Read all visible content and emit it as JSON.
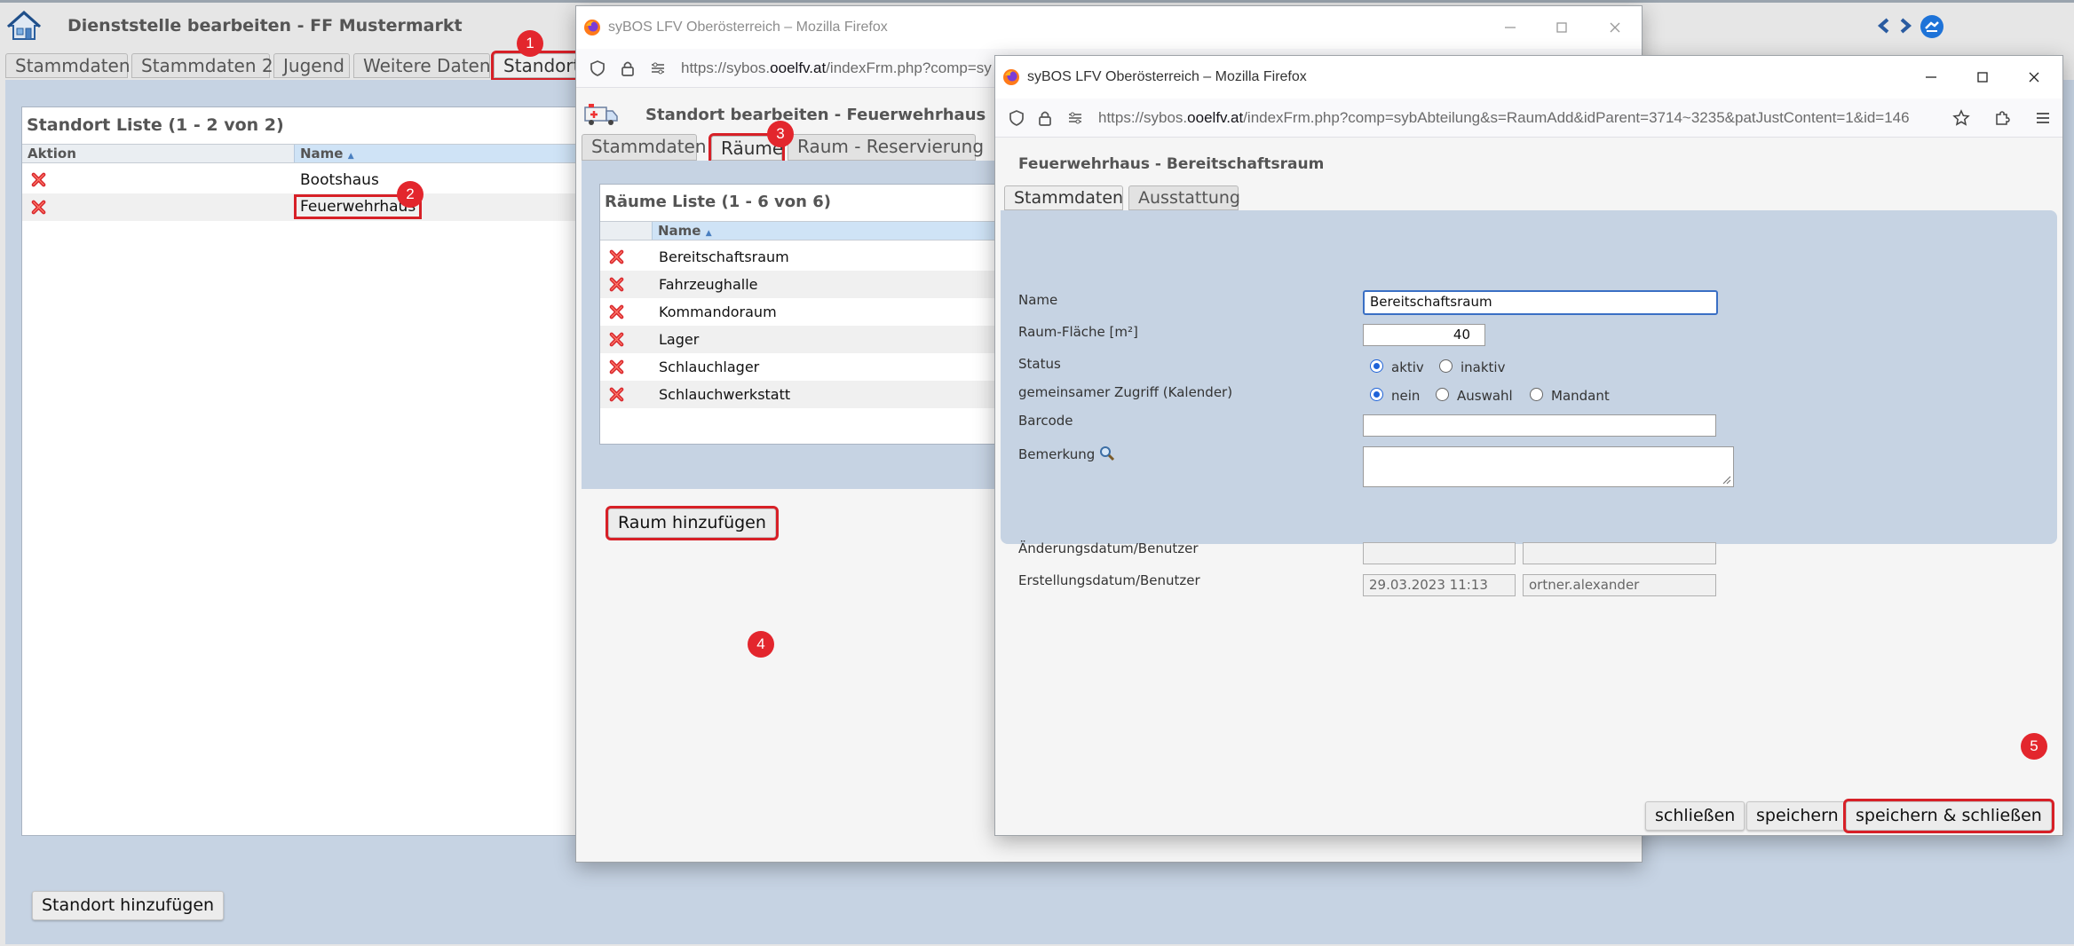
{
  "main": {
    "title": "Dienststelle bearbeiten - FF Mustermarkt",
    "tabs": [
      "Stammdaten",
      "Stammdaten 2",
      "Jugend",
      "Weitere Daten",
      "Standort"
    ],
    "list_title": "Standort Liste (1 - 2 von 2)",
    "columns": {
      "action": "Aktion",
      "name": "Name"
    },
    "rows": [
      "Bootshaus",
      "Feuerwehrhaus"
    ],
    "add_button": "Standort hinzufügen"
  },
  "window1": {
    "title": "syBOS LFV Oberösterreich – Mozilla Firefox",
    "url_prefix": "https://sybos.",
    "url_domain": "ooelfv.at",
    "url_suffix": "/indexFrm.php?comp=sy",
    "page_title": "Standort bearbeiten - Feuerwehrhaus",
    "tabs": [
      "Stammdaten",
      "Räume",
      "Raum - Reservierung"
    ],
    "list_title": "Räume Liste (1 - 6 von 6)",
    "column_name": "Name",
    "rows": [
      "Bereitschaftsraum",
      "Fahrzeughalle",
      "Kommandoraum",
      "Lager",
      "Schlauchlager",
      "Schlauchwerkstatt"
    ],
    "add_button": "Raum hinzufügen"
  },
  "window2": {
    "title": "syBOS LFV Oberösterreich – Mozilla Firefox",
    "url_prefix": "https://sybos.",
    "url_domain": "ooelfv.at",
    "url_suffix": "/indexFrm.php?comp=sybAbteilung&s=RaumAdd&idParent=3714~3235&patJustContent=1&id=146",
    "page_title": "Feuerwehrhaus - Bereitschaftsraum",
    "tabs": [
      "Stammdaten",
      "Ausstattung"
    ],
    "form": {
      "name_label": "Name",
      "name_value": "Bereitschaftsraum",
      "area_label": "Raum-Fläche [m²]",
      "area_value": "40",
      "status_label": "Status",
      "status_options": [
        "aktiv",
        "inaktiv"
      ],
      "access_label": "gemeinsamer Zugriff (Kalender)",
      "access_options": [
        "nein",
        "Auswahl",
        "Mandant"
      ],
      "barcode_label": "Barcode",
      "barcode_value": "",
      "remark_label": "Bemerkung",
      "changed_label": "Änderungsdatum/Benutzer",
      "changed_date": "",
      "changed_user": "",
      "created_label": "Erstellungsdatum/Benutzer",
      "created_date": "29.03.2023 11:13",
      "created_user": "ortner.alexander"
    },
    "buttons": {
      "close": "schließen",
      "save": "speichern",
      "save_close": "speichern & schließen"
    }
  },
  "badges": [
    "1",
    "2",
    "3",
    "4",
    "5"
  ],
  "colors": {
    "highlight": "#d72027",
    "badge": "#e3262d",
    "panel": "#c6d3e3",
    "radio_accent": "#1f63d8"
  },
  "icons": [
    "home-building-icon",
    "delete-x-icon",
    "firefox-icon",
    "ambulance-icon",
    "magnifier-icon"
  ]
}
